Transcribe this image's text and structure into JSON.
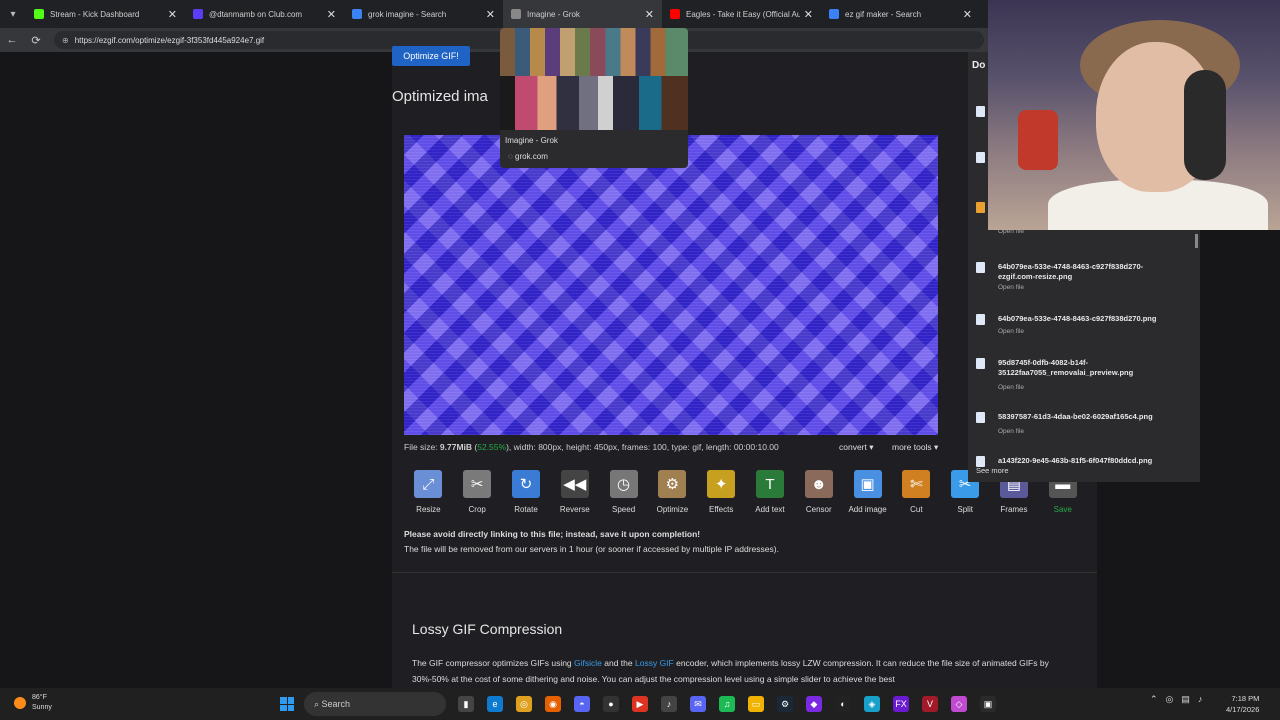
{
  "tabs": [
    {
      "title": "Stream - Kick Dashboard",
      "color": "#53fc18"
    },
    {
      "title": "@dtanmamb on Club.com",
      "color": "#5b3df5"
    },
    {
      "title": "grok imagine - Search",
      "color": "#3b82f6"
    },
    {
      "title": "Imagine - Grok",
      "color": "#888888"
    },
    {
      "title": "Eagles - Take it Easy (Official Audio)",
      "color": "#ff0000"
    },
    {
      "title": "ez gif maker - Search",
      "color": "#3b82f6"
    }
  ],
  "address": {
    "url": "https://ezgif.com/optimize/ezgif-3f353fd445a924e7.gif"
  },
  "preview": {
    "title": "Imagine - Grok",
    "url": "grok.com"
  },
  "main": {
    "optimize_label": "Optimize GIF!",
    "heading": "Optimized ima",
    "file": {
      "prefix": "File size: ",
      "size": "9.77MiB",
      "pct": "52.55%",
      "rest": "width: 800px, height: 450px, frames: 100, type: gif, length: 00:00:10.00"
    },
    "convert_label": "convert ▾",
    "more_tools_label": "more tools ▾",
    "tools": [
      {
        "label": "Resize",
        "icon": "resize-icon",
        "glyph": "⤢",
        "color": "#6b8fd6"
      },
      {
        "label": "Crop",
        "icon": "crop-icon",
        "glyph": "✂",
        "color": "#7a7a7a"
      },
      {
        "label": "Rotate",
        "icon": "rotate-icon",
        "glyph": "↻",
        "color": "#3a7bd5"
      },
      {
        "label": "Reverse",
        "icon": "reverse-icon",
        "glyph": "◀◀",
        "color": "#444444"
      },
      {
        "label": "Speed",
        "icon": "speed-icon",
        "glyph": "◷",
        "color": "#777777"
      },
      {
        "label": "Optimize",
        "icon": "optimize-icon",
        "glyph": "⚙",
        "color": "#a08050"
      },
      {
        "label": "Effects",
        "icon": "effects-icon",
        "glyph": "✦",
        "color": "#c8a020"
      },
      {
        "label": "Add text",
        "icon": "add-text-icon",
        "glyph": "T",
        "color": "#2a7a3a"
      },
      {
        "label": "Censor",
        "icon": "censor-icon",
        "glyph": "☻",
        "color": "#8a6a5a"
      },
      {
        "label": "Add image",
        "icon": "add-image-icon",
        "glyph": "▣",
        "color": "#4a90e2"
      },
      {
        "label": "Cut",
        "icon": "cut-icon",
        "glyph": "✄",
        "color": "#d08020"
      },
      {
        "label": "Split",
        "icon": "split-icon",
        "glyph": "✂",
        "color": "#3a9be8"
      },
      {
        "label": "Frames",
        "icon": "frames-icon",
        "glyph": "▤",
        "color": "#5a5a9a"
      },
      {
        "label": "Save",
        "icon": "save-icon",
        "glyph": "▬",
        "color": "#555555",
        "label_color": "#27a844"
      }
    ],
    "warning": "Please avoid directly linking to this file; instead, save it upon completion!",
    "note": "The file will be removed from our servers in 1 hour (or sooner if accessed by multiple IP addresses).",
    "section_title": "Lossy GIF Compression",
    "para": {
      "p1": "The GIF compressor optimizes GIFs using ",
      "link1": "Gifsicle",
      "p2": " and the ",
      "link2": "Lossy GIF",
      "p3": " encoder, which implements lossy LZW compression. It can reduce the file size of animated GIFs by 30%-50% at the cost of some dithering and noise. You can adjust the compression level using a simple slider to achieve the best"
    }
  },
  "downloads": {
    "title": "Do",
    "items": [
      {
        "name": "64b079ea-533e-4748-8463-c927f838d270-ezgif.com-resize.png",
        "open": "Open file"
      },
      {
        "name": "64b079ea-533e-4748-8463-c927f838d270.png",
        "open": "Open file"
      },
      {
        "name": "95d8745f-0dfb-4082-b14f-35122faa7055_removalai_preview.png",
        "open": "Open file"
      },
      {
        "name": "58397587-61d3-4daa-be02-6029af165c4.png",
        "open": "Open file"
      },
      {
        "name": "a143f220-9e45-463b-81f5-6f047f80ddcd.png",
        "open": ""
      }
    ],
    "top_open": "Open file",
    "see_more": "See more"
  },
  "taskbar": {
    "temp": "86°F",
    "cond": "Sunny",
    "search": "Search",
    "time": "7:18 PM",
    "date": "4/17/2026"
  }
}
